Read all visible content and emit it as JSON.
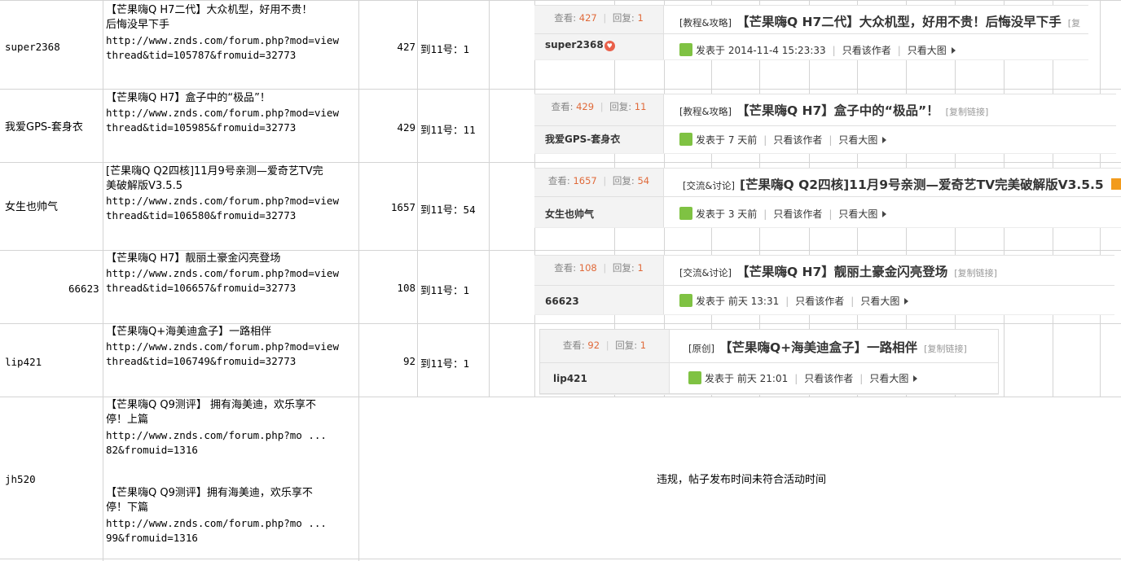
{
  "rows": [
    {
      "author": "super2368",
      "title_lines": [
        "【芒果嗨Q H7二代】大众机型，好用不贵！",
        "后悔没早下手"
      ],
      "url_lines": [
        "http://www.znds.com/forum.php?mod=view",
        "thread&tid=105787&fromuid=32773"
      ],
      "views": "427",
      "signin": "到11号：1"
    },
    {
      "author": "我爱GPS-套身衣",
      "title_lines": [
        "【芒果嗨Q H7】盒子中的“极品”！"
      ],
      "url_lines": [
        "http://www.znds.com/forum.php?mod=view",
        "thread&tid=105985&fromuid=32773"
      ],
      "views": "429",
      "signin": "到11号：11"
    },
    {
      "author": "女生也帅气",
      "title_lines": [
        "[芒果嗨Q Q2四核]11月9号亲测—爱奇艺TV完",
        "美破解版V3.5.5"
      ],
      "url_lines": [
        "http://www.znds.com/forum.php?mod=view",
        "thread&tid=106580&fromuid=32773"
      ],
      "views": "1657",
      "signin": "到11号：54"
    },
    {
      "author": "66623",
      "title_lines": [
        "【芒果嗨Q H7】靓丽土豪金闪亮登场"
      ],
      "url_lines": [
        "http://www.znds.com/forum.php?mod=view",
        "thread&tid=106657&fromuid=32773"
      ],
      "views": "108",
      "signin": "到11号：1"
    },
    {
      "author": "lip421",
      "title_lines": [
        "【芒果嗨Q+海美迪盒子】一路相伴"
      ],
      "url_lines": [
        "http://www.znds.com/forum.php?mod=view",
        "thread&tid=106749&fromuid=32773"
      ],
      "views": "92",
      "signin": "到11号：1"
    },
    {
      "author": "jh520",
      "block1_lines": [
        "【芒果嗨Q Q9测评】 拥有海美迪，欢乐享不",
        "停！上篇",
        "http://www.znds.com/forum.php?mo ...",
        "82&fromuid=1316"
      ],
      "block2_lines": [
        "【芒果嗨Q Q9测评】拥有海美迪，欢乐享不",
        "停！下篇",
        "http://www.znds.com/forum.php?mo ...",
        "99&fromuid=1316"
      ],
      "note": "违规，帖子发布时间未符合活动时间"
    }
  ],
  "posts": [
    {
      "views_label": "查看:",
      "views": "427",
      "replies_label": "回复:",
      "replies": "1",
      "author": "super2368",
      "category": "[教程&攻略]",
      "title": "【芒果嗨Q H7二代】大众机型，好用不贵！后悔没早下手",
      "copy_link": "[复",
      "posted": "发表于 2014-11-4 15:23:33",
      "only_author": "只看该作者",
      "only_images": "只看大图"
    },
    {
      "views_label": "查看:",
      "views": "429",
      "replies_label": "回复:",
      "replies": "11",
      "author": "我爱GPS-套身衣",
      "category": "[教程&攻略]",
      "title": "【芒果嗨Q H7】盒子中的“极品”！",
      "copy_link": "[复制链接]",
      "posted": "发表于 7 天前",
      "only_author": "只看该作者",
      "only_images": "只看大图"
    },
    {
      "views_label": "查看:",
      "views": "1657",
      "replies_label": "回复:",
      "replies": "54",
      "author": "女生也帅气",
      "category": "[交流&讨论]",
      "title": "[芒果嗨Q Q2四核]11月9号亲测—爱奇艺TV完美破解版V3.5.5",
      "copy_link": "",
      "posted": "发表于 3 天前",
      "only_author": "只看该作者",
      "only_images": "只看大图"
    },
    {
      "views_label": "查看:",
      "views": "108",
      "replies_label": "回复:",
      "replies": "1",
      "author": "66623",
      "category": "[交流&讨论]",
      "title": "【芒果嗨Q H7】靓丽土豪金闪亮登场",
      "copy_link": "[复制链接]",
      "posted": "发表于 前天 13:31",
      "only_author": "只看该作者",
      "only_images": "只看大图"
    },
    {
      "views_label": "查看:",
      "views": "92",
      "replies_label": "回复:",
      "replies": "1",
      "author": "lip421",
      "category": "[原创]",
      "title": "【芒果嗨Q+海美迪盒子】一路相伴",
      "copy_link": "[复制链接]",
      "posted": "发表于 前天 21:01",
      "only_author": "只看该作者",
      "only_images": "只看大图"
    }
  ],
  "colors": {
    "grid": "#d4d4d4",
    "stat_value": "#e06a3a",
    "avatar_green": "#7fc243",
    "side_bg": "#f3f3f3"
  }
}
